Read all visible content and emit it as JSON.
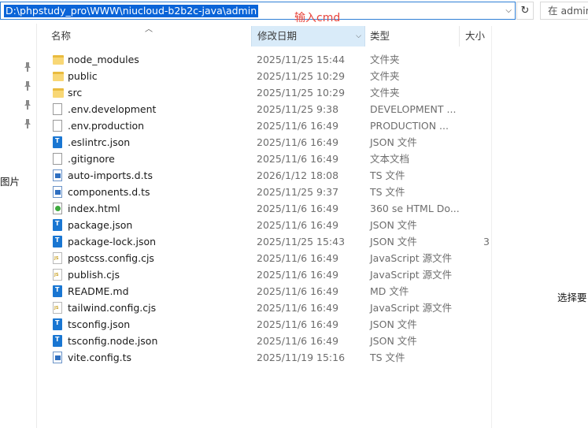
{
  "address": {
    "path": "D:\\phpstudy_pro\\WWW\\niucloud-b2b2c-java\\admin",
    "refresh_icon": "refresh-icon",
    "search_placeholder": "在 admin"
  },
  "annotation": "输入cmd",
  "nav": {
    "pins": [
      "pin-icon",
      "pin-icon",
      "pin-icon",
      "pin-icon"
    ],
    "label": "图片"
  },
  "columns": {
    "name": "名称",
    "date": "修改日期",
    "type": "类型",
    "size": "大小"
  },
  "files": [
    {
      "name": "node_modules",
      "date": "2025/11/25 15:44",
      "type": "文件夹",
      "size": "",
      "icon": "folder"
    },
    {
      "name": "public",
      "date": "2025/11/25 10:29",
      "type": "文件夹",
      "size": "",
      "icon": "folder"
    },
    {
      "name": "src",
      "date": "2025/11/25 10:29",
      "type": "文件夹",
      "size": "",
      "icon": "folder"
    },
    {
      "name": ".env.development",
      "date": "2025/11/25 9:38",
      "type": "DEVELOPMENT ...",
      "size": "",
      "icon": "file"
    },
    {
      "name": ".env.production",
      "date": "2025/11/6 16:49",
      "type": "PRODUCTION ...",
      "size": "",
      "icon": "file"
    },
    {
      "name": ".eslintrc.json",
      "date": "2025/11/6 16:49",
      "type": "JSON 文件",
      "size": "",
      "icon": "json"
    },
    {
      "name": ".gitignore",
      "date": "2025/11/6 16:49",
      "type": "文本文档",
      "size": "",
      "icon": "file"
    },
    {
      "name": "auto-imports.d.ts",
      "date": "2026/1/12 18:08",
      "type": "TS 文件",
      "size": "",
      "icon": "ts"
    },
    {
      "name": "components.d.ts",
      "date": "2025/11/25 9:37",
      "type": "TS 文件",
      "size": "",
      "icon": "ts"
    },
    {
      "name": "index.html",
      "date": "2025/11/6 16:49",
      "type": "360 se HTML Do...",
      "size": "",
      "icon": "html"
    },
    {
      "name": "package.json",
      "date": "2025/11/6 16:49",
      "type": "JSON 文件",
      "size": "",
      "icon": "json"
    },
    {
      "name": "package-lock.json",
      "date": "2025/11/25 15:43",
      "type": "JSON 文件",
      "size": "3",
      "icon": "json"
    },
    {
      "name": "postcss.config.cjs",
      "date": "2025/11/6 16:49",
      "type": "JavaScript 源文件",
      "size": "",
      "icon": "js"
    },
    {
      "name": "publish.cjs",
      "date": "2025/11/6 16:49",
      "type": "JavaScript 源文件",
      "size": "",
      "icon": "js"
    },
    {
      "name": "README.md",
      "date": "2025/11/6 16:49",
      "type": "MD 文件",
      "size": "",
      "icon": "json"
    },
    {
      "name": "tailwind.config.cjs",
      "date": "2025/11/6 16:49",
      "type": "JavaScript 源文件",
      "size": "",
      "icon": "js"
    },
    {
      "name": "tsconfig.json",
      "date": "2025/11/6 16:49",
      "type": "JSON 文件",
      "size": "",
      "icon": "json"
    },
    {
      "name": "tsconfig.node.json",
      "date": "2025/11/6 16:49",
      "type": "JSON 文件",
      "size": "",
      "icon": "json"
    },
    {
      "name": "vite.config.ts",
      "date": "2025/11/19 15:16",
      "type": "TS 文件",
      "size": "",
      "icon": "ts"
    }
  ],
  "right_hint": "选择要"
}
